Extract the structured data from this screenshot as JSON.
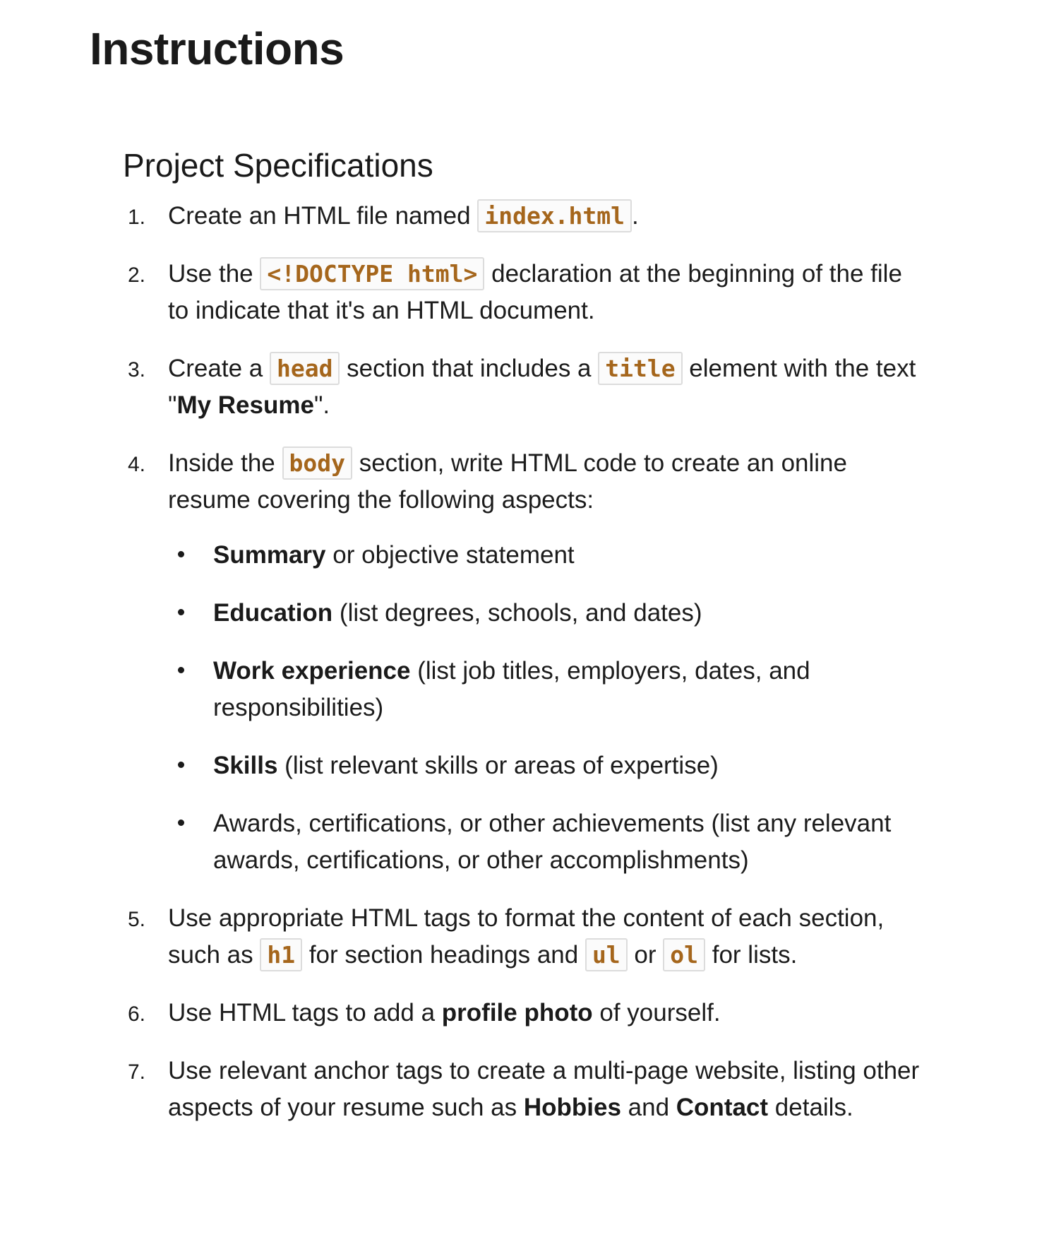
{
  "page_title": "Instructions",
  "section_title": "Project Specifications",
  "items": [
    {
      "num": "1.",
      "t1": "Create an HTML file named ",
      "c1": "index.html",
      "t2": "."
    },
    {
      "num": "2.",
      "t1": "Use the ",
      "c1": "<!DOCTYPE html>",
      "t2": " declaration at the beginning of the file to indicate that it's an HTML document."
    },
    {
      "num": "3.",
      "t1": "Create a ",
      "c1": "head",
      "t2": " section that includes a ",
      "c2": "title",
      "t3": " element with the text \"",
      "b1": "My Resume",
      "t4": "\"."
    },
    {
      "num": "4.",
      "t1": "Inside the ",
      "c1": "body",
      "t2": " section, write HTML code to create an online resume covering the following aspects:"
    },
    {
      "num": "5.",
      "t1": "Use appropriate HTML tags to format the content of each section, such as ",
      "c1": "h1",
      "t2": " for section headings and ",
      "c2": "ul",
      "t3": " or ",
      "c3": "ol",
      "t4": " for lists."
    },
    {
      "num": "6.",
      "t1": "Use HTML tags to add a ",
      "b1": "profile photo",
      "t2": " of yourself."
    },
    {
      "num": "7.",
      "t1": "Use relevant anchor tags to create a multi-page website, listing other aspects of your resume such as ",
      "b1": "Hobbies",
      "t2": " and ",
      "b2": "Contact",
      "t3": " details."
    }
  ],
  "aspects": [
    {
      "bold": "Summary",
      "text": " or objective statement"
    },
    {
      "bold": "Education",
      "text": " (list degrees, schools, and dates)"
    },
    {
      "bold": "Work experience",
      "text": " (list job titles, employers, dates, and responsibilities)"
    },
    {
      "bold": "Skills",
      "text": " (list relevant skills or areas of expertise)"
    },
    {
      "text": "Awards, certifications, or other achievements (list any relevant awards, certifications, or other accomplishments)"
    }
  ],
  "colors": {
    "code_text": "#a5661c",
    "code_border": "#dcdcdc",
    "body_text": "#1c1c1c"
  }
}
